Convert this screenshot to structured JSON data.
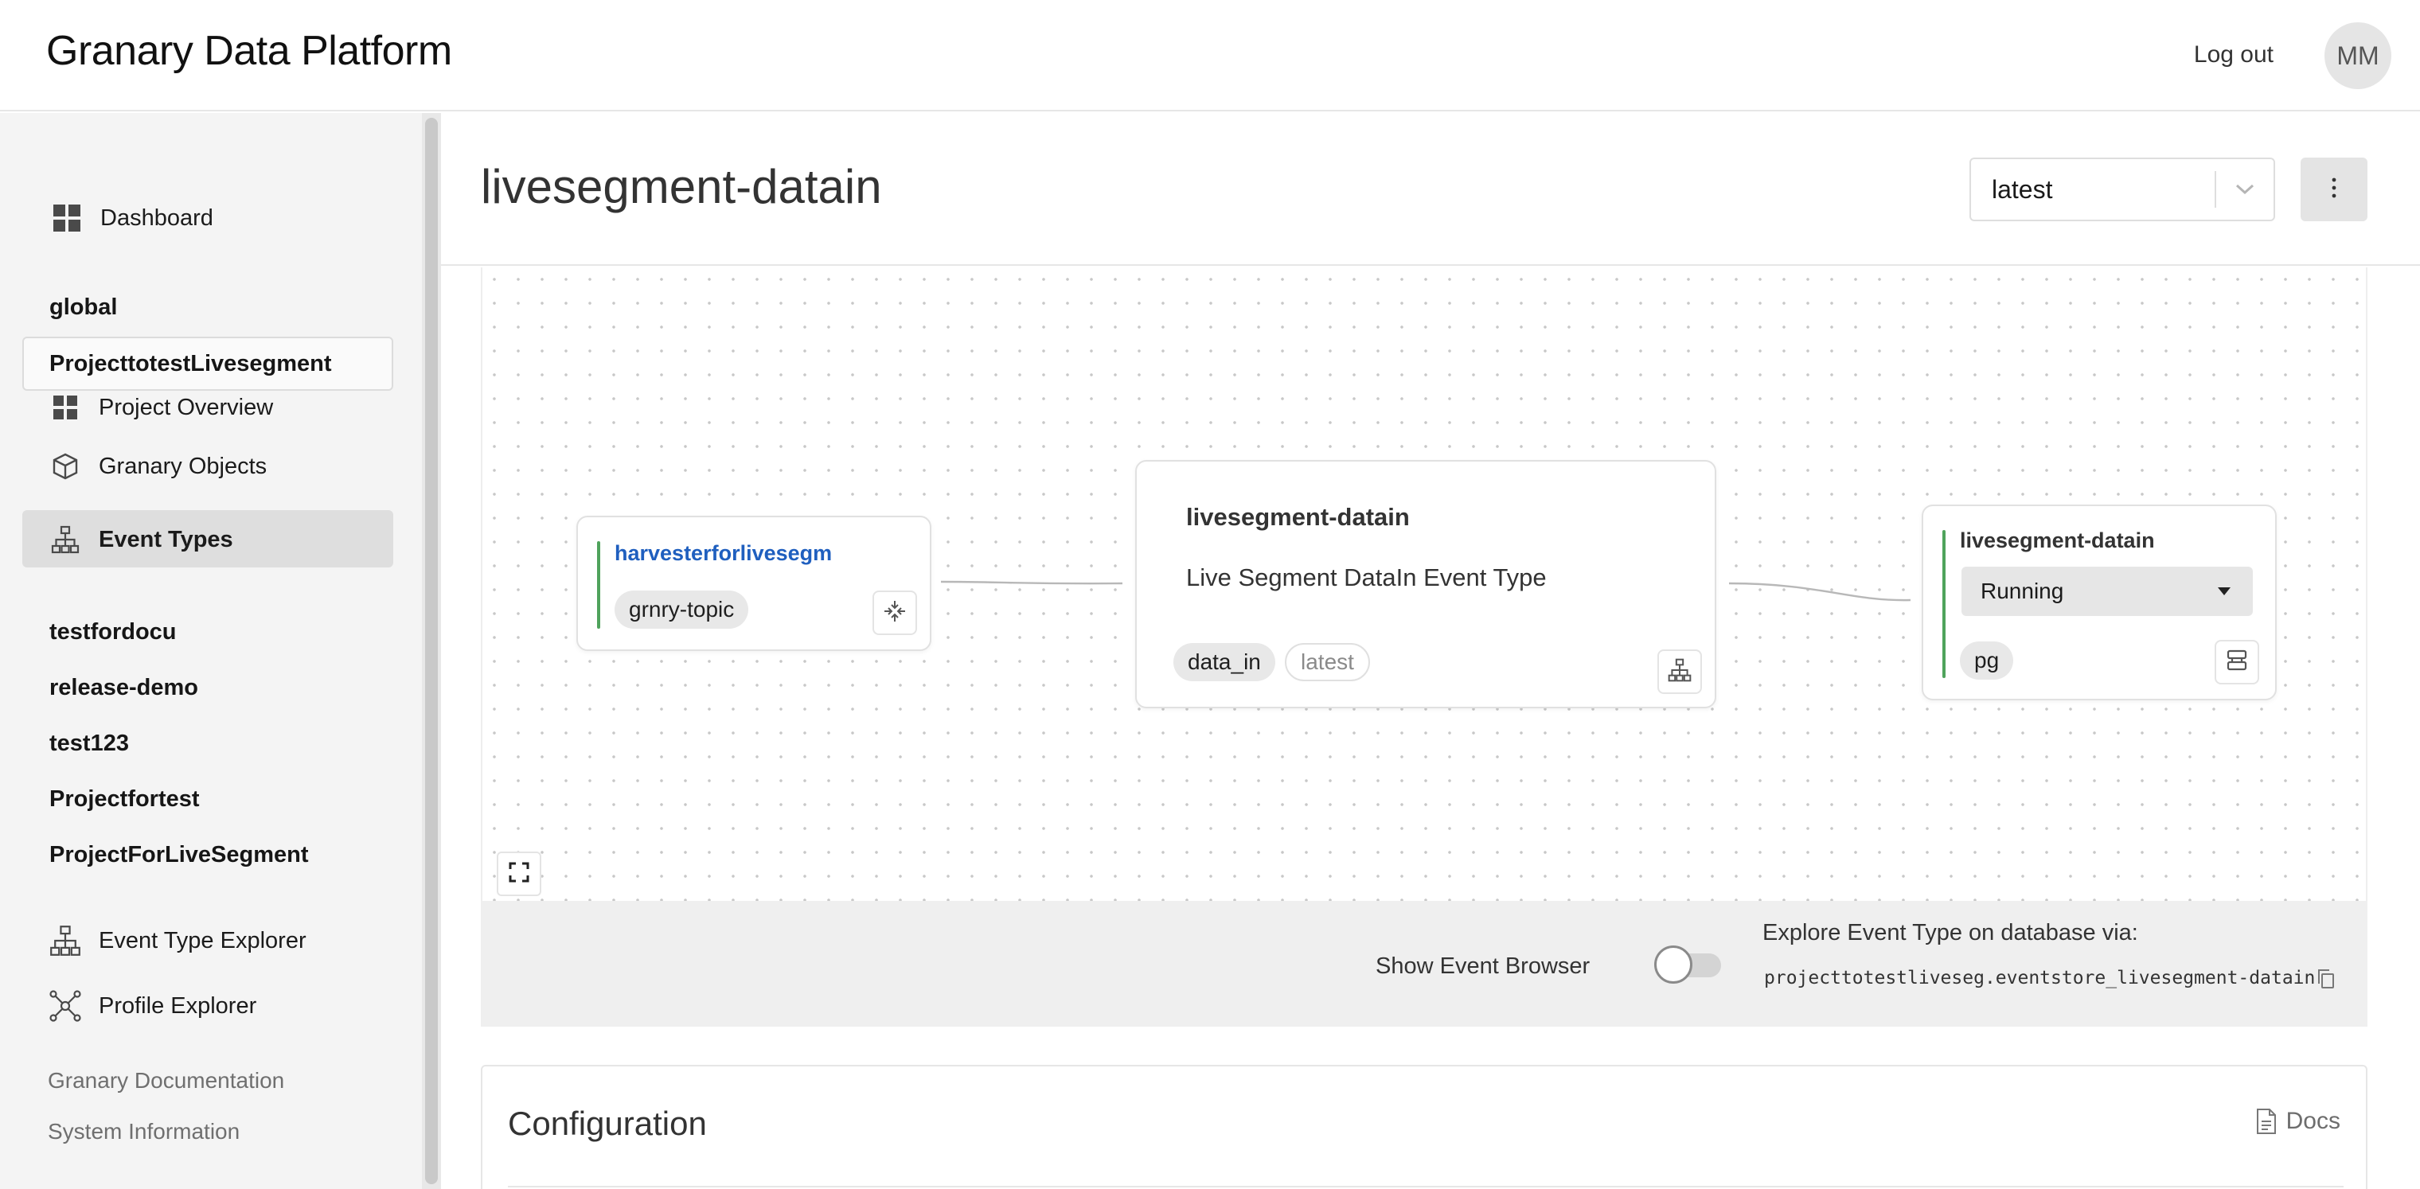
{
  "header": {
    "brand": "Granary Data Platform",
    "logout_label": "Log out",
    "avatar_initials": "MM"
  },
  "sidebar": {
    "dashboard_label": "Dashboard",
    "projects_top": [
      "global"
    ],
    "selected_project": "ProjecttotestLivesegment",
    "project_nav": [
      {
        "label": "Project Overview",
        "icon": "grid-icon"
      },
      {
        "label": "Granary Objects",
        "icon": "cube-icon"
      },
      {
        "label": "Event Types",
        "icon": "hierarchy-icon"
      }
    ],
    "active_item": "Event Types",
    "projects_bottom": [
      "testfordocu",
      "release-demo",
      "test123",
      "Projectfortest",
      "ProjectForLiveSegment"
    ],
    "explorers": [
      {
        "label": "Event Type Explorer",
        "icon": "hierarchy-icon"
      },
      {
        "label": "Profile Explorer",
        "icon": "network-icon"
      }
    ],
    "footer_links": [
      "Granary Documentation",
      "System Information"
    ]
  },
  "page": {
    "title": "livesegment-datain",
    "version_value": "latest"
  },
  "graph": {
    "source_node": {
      "title": "harvesterforlivesegm",
      "tag": "grnry-topic"
    },
    "center_node": {
      "title": "livesegment-datain",
      "description": "Live Segment DataIn Event Type",
      "tags": [
        "data_in",
        "latest"
      ]
    },
    "sink_node": {
      "title": "livesegment-datain",
      "status": "Running",
      "tag": "pg"
    },
    "colors": {
      "accent_green": "#4fa35c",
      "link_blue": "#1f5fbf"
    }
  },
  "infobar": {
    "show_event_browser_label": "Show Event Browser",
    "show_event_browser_on": false,
    "explore_label": "Explore Event Type on database via:",
    "explore_value": "projecttotestliveseg.eventstore_livesegment-datain"
  },
  "configuration": {
    "title": "Configuration",
    "docs_label": "Docs"
  }
}
